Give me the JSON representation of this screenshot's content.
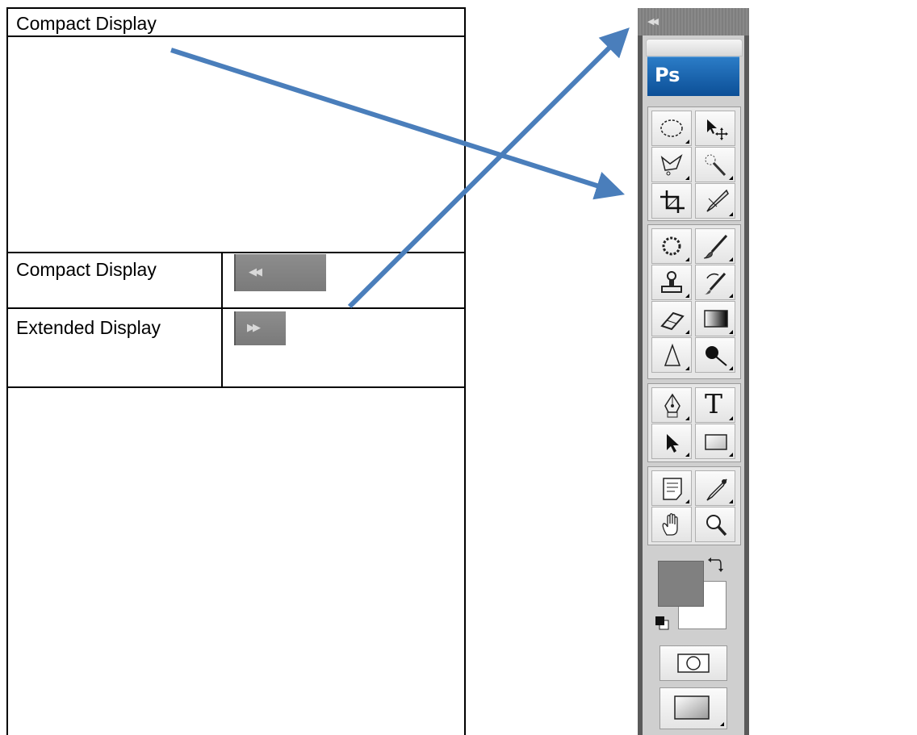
{
  "table": {
    "header_label": "Compact Display",
    "rows": [
      {
        "label": "Compact Display",
        "button_icon": "double-chevron-left-icon",
        "button_glyph": "◀◀"
      },
      {
        "label": "Extended Display",
        "button_icon": "double-chevron-right-icon",
        "button_glyph": "▶▶"
      }
    ]
  },
  "toolbar": {
    "header_glyph": "◀◀",
    "logo_text": "Ps",
    "tools": [
      "elliptical-marquee-tool-icon",
      "move-tool-icon",
      "polygonal-lasso-tool-icon",
      "quick-selection-tool-icon",
      "crop-tool-icon",
      "slice-tool-icon",
      "spot-healing-brush-tool-icon",
      "brush-tool-icon",
      "clone-stamp-tool-icon",
      "history-brush-tool-icon",
      "eraser-tool-icon",
      "gradient-tool-icon",
      "blur-tool-icon",
      "dodge-tool-icon",
      "pen-tool-icon",
      "type-tool-icon",
      "path-selection-tool-icon",
      "rectangle-tool-icon",
      "notes-tool-icon",
      "eyedropper-tool-icon",
      "hand-tool-icon",
      "zoom-tool-icon"
    ],
    "type_tool_glyph": "T",
    "colors": {
      "foreground": "#808080",
      "background": "#ffffff",
      "accent": "#4a7ebb"
    }
  }
}
